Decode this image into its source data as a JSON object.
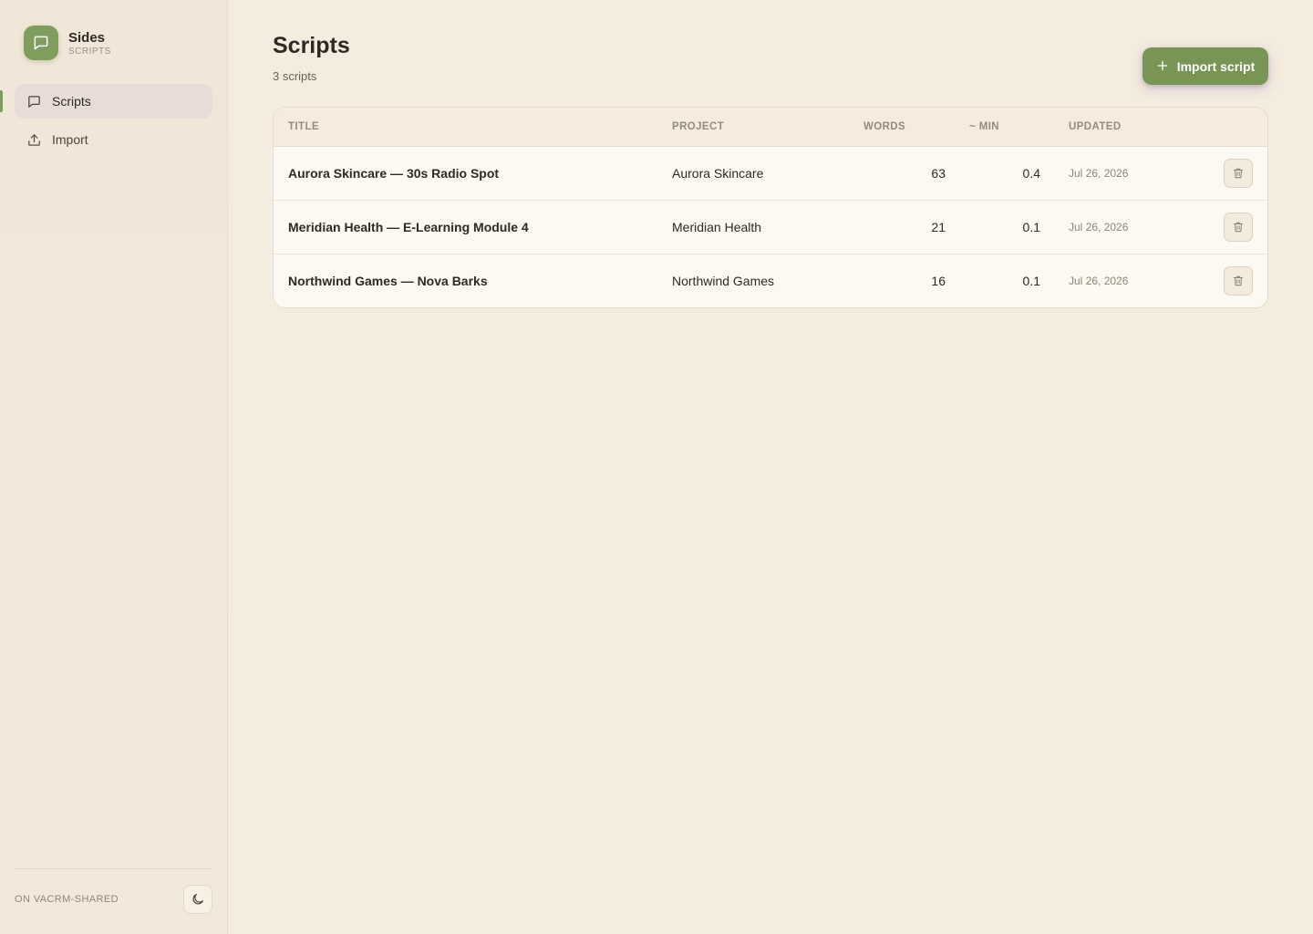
{
  "app": {
    "name": "Sides",
    "section_label": "SCRIPTS"
  },
  "sidebar": {
    "items": [
      {
        "label": "Scripts",
        "icon": "chat-bubble-icon",
        "active": true
      },
      {
        "label": "Import",
        "icon": "upload-icon",
        "active": false
      }
    ],
    "workspace": "ON VACRM-SHARED",
    "theme_toggle_icon": "moon-icon"
  },
  "header": {
    "title": "Scripts",
    "count": "3 scripts",
    "import_button": {
      "icon": "plus-icon",
      "label": "Import script"
    }
  },
  "table": {
    "columns": [
      "TITLE",
      "PROJECT",
      "WORDS",
      "~ MIN",
      "UPDATED"
    ],
    "rows": [
      {
        "title": "Aurora Skincare — 30s Radio Spot",
        "project": "Aurora Skincare",
        "words": "63",
        "min": "0.4",
        "updated": "Jul 26, 2026"
      },
      {
        "title": "Meridian Health — E-Learning Module 4",
        "project": "Meridian Health",
        "words": "21",
        "min": "0.1",
        "updated": "Jul 26, 2026"
      },
      {
        "title": "Northwind Games — Nova Barks",
        "project": "Northwind Games",
        "words": "16",
        "min": "0.1",
        "updated": "Jul 26, 2026"
      }
    ]
  },
  "colors": {
    "accent": "#789556",
    "background": "#f4ecdf",
    "active_nav": "#e8dcd9"
  }
}
